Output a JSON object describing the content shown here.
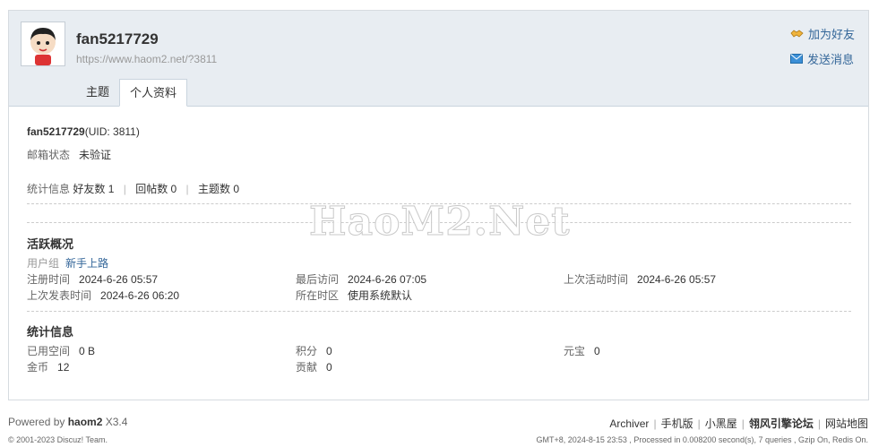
{
  "profile": {
    "username": "fan5217729",
    "url": "https://www.haom2.net/?3811",
    "actions": {
      "add_friend": "加为好友",
      "send_message": "发送消息"
    },
    "tabs": [
      "主题",
      "个人资料"
    ]
  },
  "details": {
    "name_uid": "fan5217729",
    "uid_text": "(UID: 3811)",
    "email_label": "邮箱状态",
    "email_value": "未验证",
    "stats_label": "统计信息",
    "friends": "好友数 1",
    "replies": "回帖数 0",
    "threads": "主题数 0"
  },
  "activity": {
    "title": "活跃概况",
    "group_label": "用户组",
    "group_value": "新手上路",
    "reg_label": "注册时间",
    "reg_value": "2024-6-26 05:57",
    "last_visit_label": "最后访问",
    "last_visit_value": "2024-6-26 07:05",
    "last_active_label": "上次活动时间",
    "last_active_value": "2024-6-26 05:57",
    "last_post_label": "上次发表时间",
    "last_post_value": "2024-6-26 06:20",
    "tz_label": "所在时区",
    "tz_value": "使用系统默认"
  },
  "stats": {
    "title": "统计信息",
    "space_label": "已用空间",
    "space_value": "0 B",
    "points_label": "积分",
    "points_value": "0",
    "yuanbao_label": "元宝",
    "yuanbao_value": "0",
    "gold_label": "金币",
    "gold_value": "12",
    "contrib_label": "贡献",
    "contrib_value": "0"
  },
  "watermark": "HaoM2.Net",
  "footer": {
    "powered_prefix": "Powered by ",
    "powered_brand": "haom2",
    "powered_version": " X3.4",
    "copyright": "© 2001-2023 Discuz! Team.",
    "links": [
      "Archiver",
      "手机版",
      "小黑屋",
      "翎风引擎论坛",
      "网站地图"
    ],
    "gmt": "GMT+8, 2024-8-15 23:53 , Processed in 0.008200 second(s), 7 queries , Gzip On, Redis On."
  },
  "colors": {
    "header_bg": "#e8edf2",
    "link": "#336699",
    "border": "#d6dbe0"
  }
}
